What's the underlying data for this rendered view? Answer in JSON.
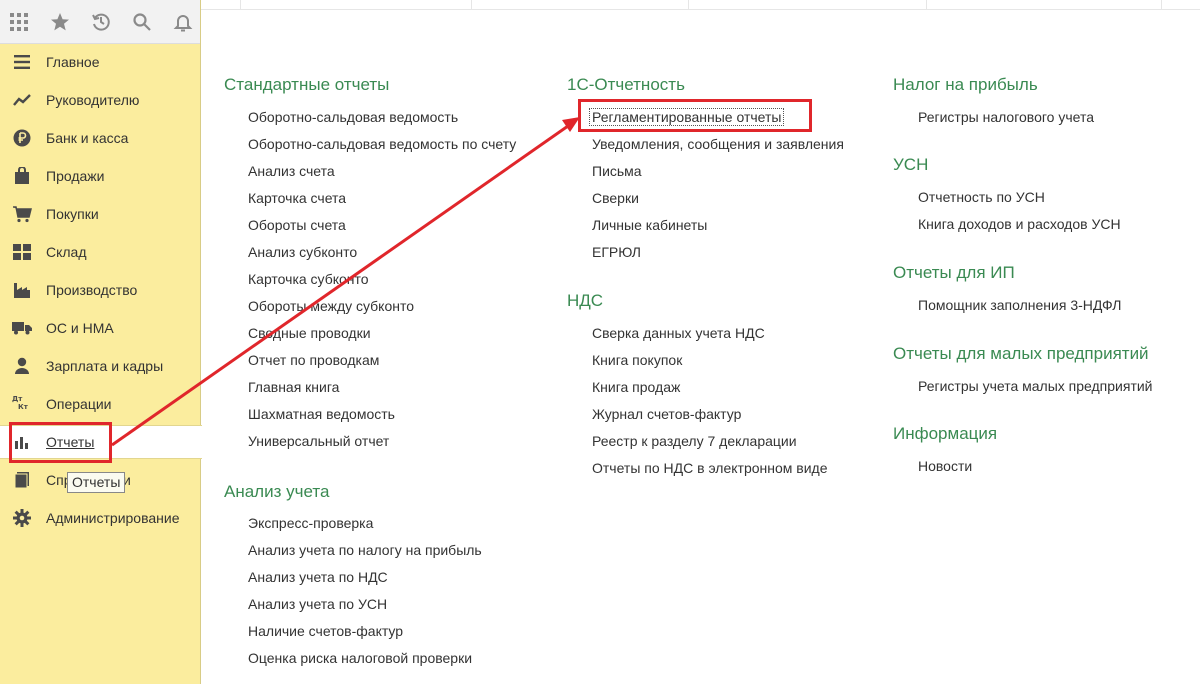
{
  "sidebar": {
    "toolbar_icons": [
      "apps-grid-icon",
      "star-icon",
      "history-icon",
      "search-icon",
      "bell-icon"
    ],
    "items": [
      {
        "label": "Главное",
        "icon": "menu-lines-icon"
      },
      {
        "label": "Руководителю",
        "icon": "trend-line-icon"
      },
      {
        "label": "Банк и касса",
        "icon": "ruble-coin-icon"
      },
      {
        "label": "Продажи",
        "icon": "shopping-bag-icon"
      },
      {
        "label": "Покупки",
        "icon": "cart-icon"
      },
      {
        "label": "Склад",
        "icon": "warehouse-grid-icon"
      },
      {
        "label": "Производство",
        "icon": "factory-icon"
      },
      {
        "label": "ОС и НМА",
        "icon": "truck-icon"
      },
      {
        "label": "Зарплата и кадры",
        "icon": "person-icon"
      },
      {
        "label": "Операции",
        "icon": "debit-credit-icon"
      },
      {
        "label": "Отчеты",
        "icon": "bar-chart-icon",
        "active": true
      },
      {
        "label": "Справочники",
        "icon": "book-icon"
      },
      {
        "label": "Администрирование",
        "icon": "gear-icon"
      }
    ],
    "tooltip": "Отчеты"
  },
  "columns": {
    "standard": {
      "title": "Стандартные отчеты",
      "links": [
        "Оборотно-сальдовая ведомость",
        "Оборотно-сальдовая ведомость по счету",
        "Анализ счета",
        "Карточка счета",
        "Обороты счета",
        "Анализ субконто",
        "Карточка субконто",
        "Обороты между субконто",
        "Сводные проводки",
        "Отчет по проводкам",
        "Главная книга",
        "Шахматная ведомость",
        "Универсальный отчет"
      ]
    },
    "analysis": {
      "title": "Анализ учета",
      "links": [
        "Экспресс-проверка",
        "Анализ учета по налогу на прибыль",
        "Анализ учета по НДС",
        "Анализ учета по УСН",
        "Наличие счетов-фактур",
        "Оценка риска налоговой проверки"
      ]
    },
    "otchetnost": {
      "title": "1С-Отчетность",
      "links": [
        "Регламентированные отчеты",
        "Уведомления, сообщения и заявления",
        "Письма",
        "Сверки",
        "Личные кабинеты",
        "ЕГРЮЛ"
      ]
    },
    "nds": {
      "title": "НДС",
      "links": [
        "Сверка данных учета НДС",
        "Книга покупок",
        "Книга продаж",
        "Журнал счетов-фактур",
        "Реестр к разделу 7 декларации",
        "Отчеты по НДС в электронном виде"
      ]
    },
    "profit": {
      "title": "Налог на прибыль",
      "links": [
        "Регистры налогового учета"
      ]
    },
    "usn": {
      "title": "УСН",
      "links": [
        "Отчетность по УСН",
        "Книга доходов и расходов УСН"
      ]
    },
    "ip": {
      "title": "Отчеты для ИП",
      "links": [
        "Помощник заполнения 3-НДФЛ"
      ]
    },
    "small": {
      "title": "Отчеты для малых предприятий",
      "links": [
        "Регистры учета малых предприятий"
      ]
    },
    "info": {
      "title": "Информация",
      "links": [
        "Новости"
      ]
    }
  },
  "colors": {
    "accent": "#3a8a52",
    "sidebar_bg": "#fbed9e",
    "highlight": "#e0262b"
  }
}
